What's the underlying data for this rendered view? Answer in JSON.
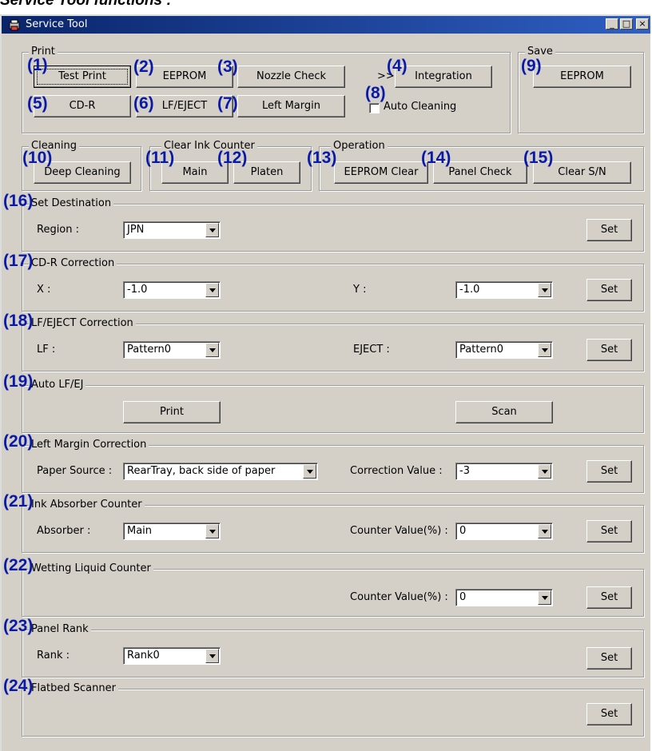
{
  "heading": "Service Tool functions :",
  "window": {
    "title": "Service Tool",
    "min_label": "_",
    "max_label": "□",
    "close_label": "×"
  },
  "print_group": {
    "legend": "Print",
    "buttons": [
      "Test Print",
      "EEPROM",
      "Nozzle Check",
      "Integration",
      "CD-R",
      "LF/EJECT",
      "Left Margin"
    ],
    "arrow": ">>",
    "checkbox_label": "Auto Cleaning",
    "checkbox_checked": false
  },
  "save_group": {
    "legend": "Save",
    "button": "EEPROM"
  },
  "cleaning_group": {
    "legend": "Cleaning",
    "button": "Deep Cleaning"
  },
  "clear_ink_group": {
    "legend": "Clear Ink Counter",
    "buttons": [
      "Main",
      "Platen"
    ]
  },
  "operation_group": {
    "legend": "Operation",
    "buttons": [
      "EEPROM Clear",
      "Panel Check",
      "Clear S/N"
    ]
  },
  "set_destination": {
    "legend": "Set Destination",
    "label": "Region :",
    "value": "JPN",
    "set": "Set"
  },
  "cdr_correction": {
    "legend": "CD-R Correction",
    "x_label": "X :",
    "x_value": "-1.0",
    "y_label": "Y :",
    "y_value": "-1.0",
    "set": "Set"
  },
  "lf_eject_correction": {
    "legend": "LF/EJECT Correction",
    "lf_label": "LF :",
    "lf_value": "Pattern0",
    "eject_label": "EJECT :",
    "eject_value": "Pattern0",
    "set": "Set"
  },
  "auto_lf_ej": {
    "legend": "Auto LF/EJ",
    "print": "Print",
    "scan": "Scan"
  },
  "left_margin_correction": {
    "legend": "Left Margin Correction",
    "source_label": "Paper Source :",
    "source_value": "RearTray, back side of paper",
    "corr_label": "Correction Value :",
    "corr_value": "-3",
    "set": "Set"
  },
  "ink_absorber_counter": {
    "legend": "Ink Absorber Counter",
    "absorber_label": "Absorber :",
    "absorber_value": "Main",
    "counter_label": "Counter Value(%) :",
    "counter_value": "0",
    "set": "Set"
  },
  "wetting_liquid_counter": {
    "legend": "Wetting Liquid Counter",
    "counter_label": "Counter Value(%) :",
    "counter_value": "0",
    "set": "Set"
  },
  "panel_rank": {
    "legend": "Panel Rank",
    "rank_label": "Rank :",
    "rank_value": "Rank0",
    "set": "Set"
  },
  "flatbed_scanner": {
    "legend": "Flatbed Scanner",
    "set": "Set"
  },
  "callouts": [
    "(1)",
    "(2)",
    "(3)",
    "(4)",
    "(5)",
    "(6)",
    "(7)",
    "(8)",
    "(9)",
    "(10)",
    "(11)",
    "(12)",
    "(13)",
    "(14)",
    "(15)",
    "(16)",
    "(17)",
    "(18)",
    "(19)",
    "(20)",
    "(21)",
    "(22)",
    "(23)",
    "(24)"
  ],
  "colors": {
    "titlebar": "#0a246a",
    "callout": "#0a1aa8",
    "face": "#d4d0c8"
  }
}
